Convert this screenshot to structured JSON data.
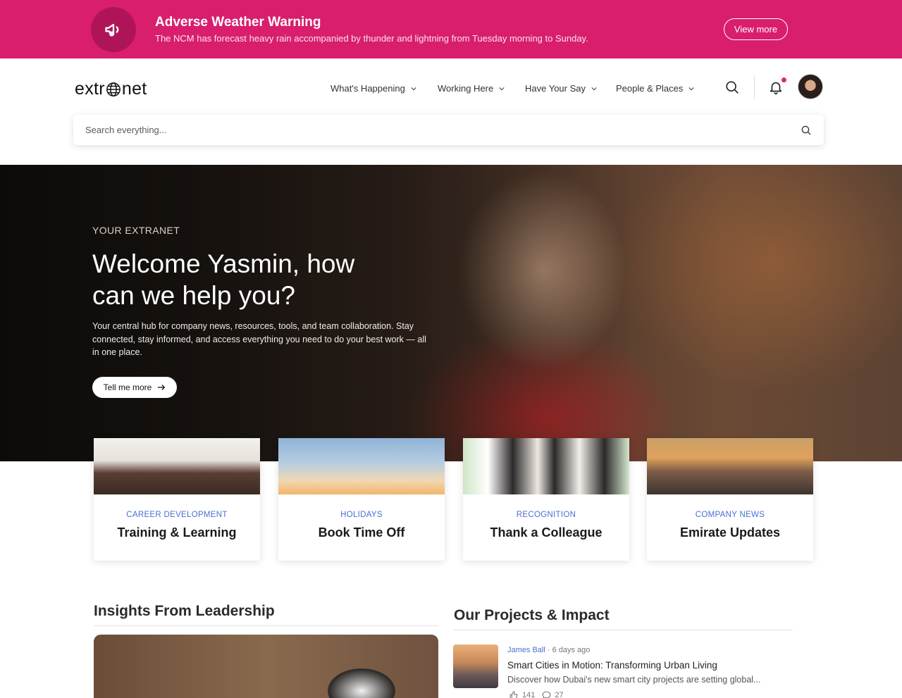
{
  "alert": {
    "title": "Adverse Weather Warning",
    "text": "The NCM has forecast heavy rain accompanied by thunder and lightning from Tuesday morning to Sunday.",
    "button": "View more",
    "icon": "megaphone-icon",
    "color": "#d91e6e"
  },
  "header": {
    "logo_left": "extr",
    "logo_right": "net",
    "nav": [
      "What's Happening",
      "Working Here",
      "Have Your Say",
      "People & Places"
    ]
  },
  "search": {
    "placeholder": "Search everything..."
  },
  "hero": {
    "eyebrow": "YOUR EXTRANET",
    "title": "Welcome Yasmin, how can we help you?",
    "text": "Your central hub for company news, resources, tools, and team collaboration. Stay connected, stay informed, and access everything you need to do your best work — all in one place.",
    "button": "Tell me more"
  },
  "cards": [
    {
      "category": "CAREER DEVELOPMENT",
      "title": "Training & Learning"
    },
    {
      "category": "HOLIDAYS",
      "title": "Book Time Off"
    },
    {
      "category": "RECOGNITION",
      "title": "Thank a Colleague"
    },
    {
      "category": "COMPANY NEWS",
      "title": "Emirate Updates"
    }
  ],
  "sections": {
    "leadership": "Insights From Leadership",
    "projects": "Our Projects & Impact"
  },
  "project": {
    "author": "James Ball",
    "time": "6 days ago",
    "title": "Smart Cities in Motion: Transforming Urban Living",
    "desc": "Discover how Dubai's new smart city projects are setting global...",
    "likes": "141",
    "comments": "27"
  },
  "colors": {
    "accent": "#4a6fd4",
    "brand": "#d91e6e"
  }
}
